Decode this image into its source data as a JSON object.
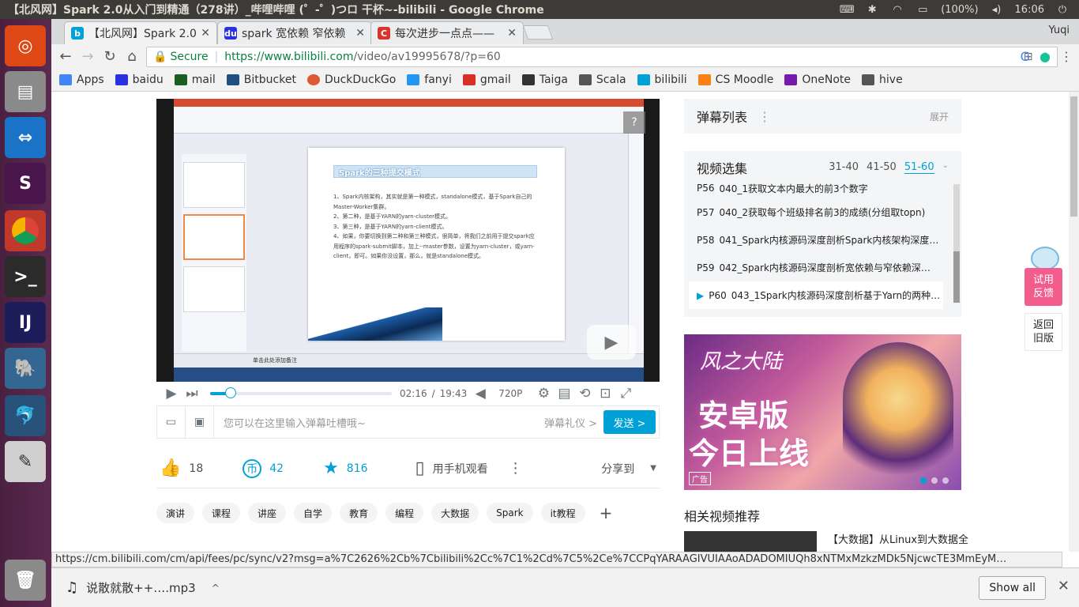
{
  "window_title": "【北风网】Spark 2.0从入门到精通（278讲）_哔哩哔哩 (゜-゜)つロ 干杯~-bilibili - Google Chrome",
  "tray": {
    "battery": "(100%)",
    "clock": "16:06"
  },
  "tabs": [
    {
      "title": "【北风网】Spark 2.0",
      "icon": "bilibili-icon"
    },
    {
      "title": "spark 宽依赖 窄依赖",
      "icon": "baidu-icon"
    },
    {
      "title": "每次进步一点点——",
      "icon": "csdn-icon"
    }
  ],
  "user_name": "Yuqi",
  "address": {
    "secure_label": "Secure",
    "url_main": "https://www.bilibili.com",
    "url_rest": "/video/av19995678/?p=60"
  },
  "bookmarks": [
    {
      "label": "Apps",
      "color": "#4285f4"
    },
    {
      "label": "baidu",
      "color": "#2932e1"
    },
    {
      "label": "mail",
      "color": "#1b5e20"
    },
    {
      "label": "Bitbucket",
      "color": "#205081"
    },
    {
      "label": "DuckDuckGo",
      "color": "#de5833"
    },
    {
      "label": "fanyi",
      "color": "#2196f3"
    },
    {
      "label": "gmail",
      "color": "#d93025"
    },
    {
      "label": "Taiga",
      "color": "#333333"
    },
    {
      "label": "Scala",
      "color": "#555555"
    },
    {
      "label": "bilibili",
      "color": "#00a1d6"
    },
    {
      "label": "CS Moodle",
      "color": "#f98012"
    },
    {
      "label": "OneNote",
      "color": "#7719aa"
    },
    {
      "label": "hive",
      "color": "#555555"
    }
  ],
  "slide": {
    "title": "Spark的三种提交模式",
    "lines": [
      "1、Spark内核架构，其实就是第一种模式，standalone模式，基于Spark自己的Master-Worker集群。",
      "2、第二种，是基于YARN的yarn-cluster模式。",
      "3、第三种，是基于YARN的yarn-client模式。",
      "4、如果，你要切换到第二种和第三种模式，很简单，将我们之前用于提交spark应用程序的spark-submit脚本，加上--master参数，设置为yarn-cluster，或yarn-client，即可。如果你没设置，那么，就是standalone模式。"
    ],
    "note": "单击此处添加备注"
  },
  "player": {
    "current_time": "02:16",
    "separator": "/",
    "duration": "19:43",
    "quality": "720P",
    "progress_fraction": 0.115
  },
  "danmaku": {
    "placeholder": "您可以在这里输入弹幕吐槽哦~",
    "gift": "弹幕礼仪 >",
    "send": "发送 >"
  },
  "actions": {
    "likes": "18",
    "coins": "42",
    "favorites": "816",
    "mobile": "用手机观看",
    "share": "分享到"
  },
  "tags": [
    "演讲",
    "课程",
    "讲座",
    "自学",
    "教育",
    "编程",
    "大数据",
    "Spark",
    "it教程"
  ],
  "danmaku_list": {
    "title": "弹幕列表",
    "expand": "展开"
  },
  "episodes": {
    "title": "视频选集",
    "ranges": [
      "31-40",
      "41-50",
      "51-60"
    ],
    "items": [
      {
        "num": "P56",
        "title": "040_1获取文本内最大的前3个数字"
      },
      {
        "num": "P57",
        "title": "040_2获取每个班级排名前3的成绩(分组取topn)"
      },
      {
        "num": "P58",
        "title": "041_Spark内核源码深度剖析Spark内核架构深度…"
      },
      {
        "num": "P59",
        "title": "042_Spark内核源码深度剖析宽依赖与窄依赖深…"
      },
      {
        "num": "P60",
        "title": "043_1Spark内核源码深度剖析基于Yarn的两种…"
      }
    ]
  },
  "ad": {
    "logo": "风之大陆",
    "line1": "安卓版",
    "line2": "今日上线",
    "tag": "广告"
  },
  "related": {
    "title": "相关视频推荐",
    "first": "【大数据】从Linux到大数据全"
  },
  "float": {
    "feedback_1": "试用",
    "feedback_2": "反馈",
    "old_1": "返回",
    "old_2": "旧版"
  },
  "status_url": "https://cm.bilibili.com/cm/api/fees/pc/sync/v2?msg=a%7C2626%2Cb%7Cbilibili%2Cc%7C1%2Cd%7C5%2Ce%7CCPqYARAAGIVUIAAoADADOMIUQh8xNTMxMzkzMDk5NjcwcTE3MmEyM…",
  "download": {
    "file": "说散就散++….mp3",
    "show_all": "Show all"
  }
}
